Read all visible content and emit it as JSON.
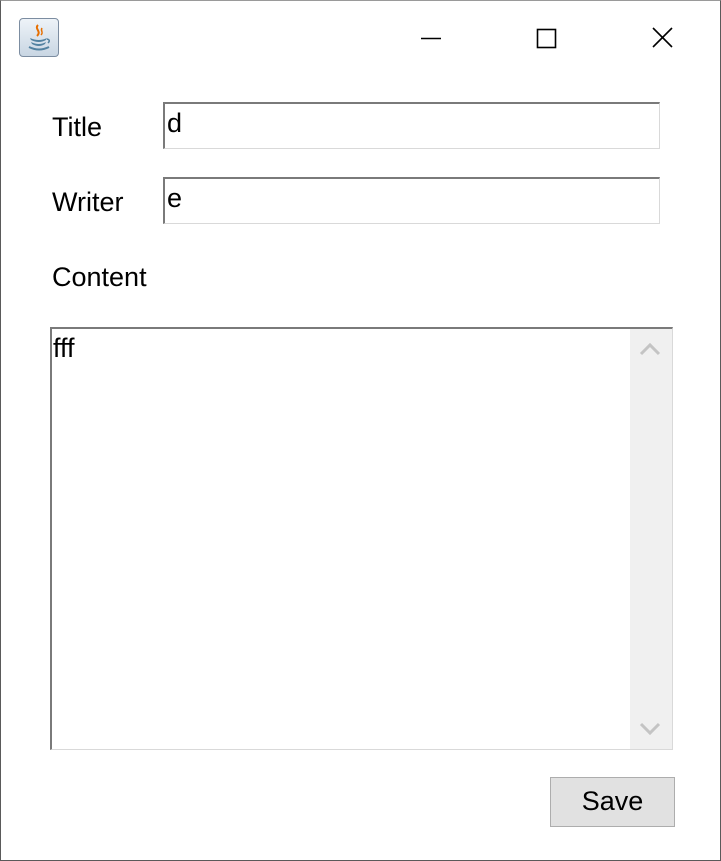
{
  "titlebar": {
    "app_icon": "java-cup-icon",
    "controls": {
      "minimize": "minimize-icon",
      "maximize": "maximize-icon",
      "close": "close-icon"
    }
  },
  "form": {
    "title_label": "Title",
    "title_value": "d",
    "writer_label": "Writer",
    "writer_value": "e",
    "content_label": "Content",
    "content_value": "fff",
    "save_label": "Save"
  },
  "scrollbar": {
    "up_icon": "chevron-up-icon",
    "down_icon": "chevron-down-icon"
  },
  "colors": {
    "button_face": "#e1e1e1",
    "scroll_track": "#f0f0f0",
    "field_border": "#7a7a7a"
  }
}
